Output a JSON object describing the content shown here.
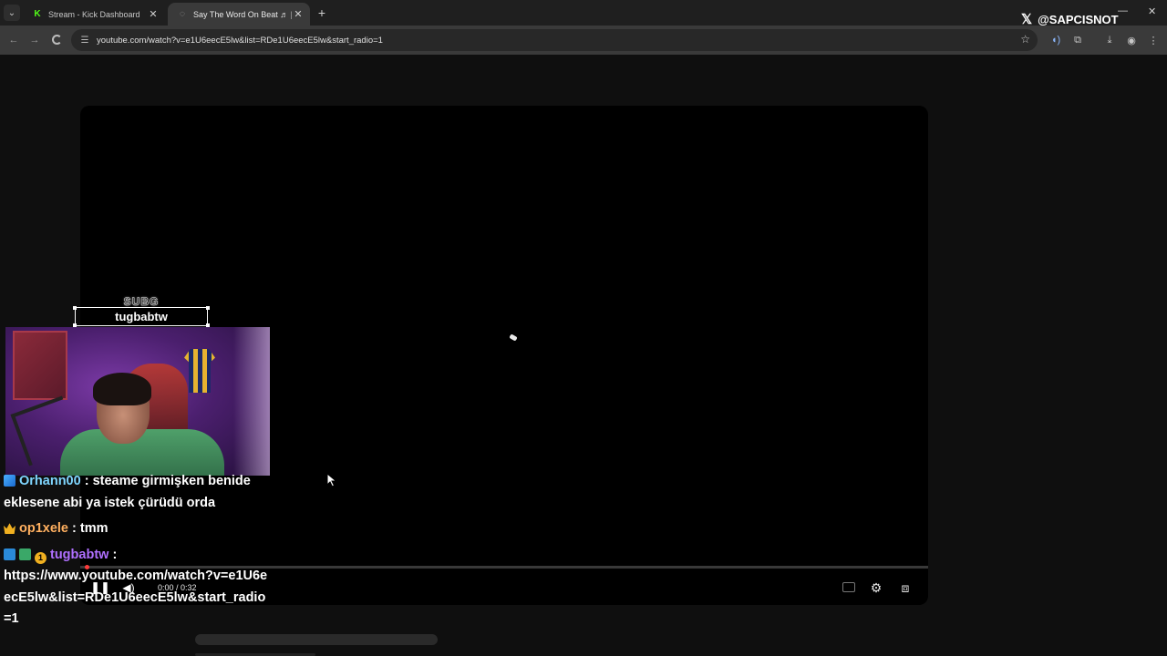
{
  "browser": {
    "tabs": [
      {
        "title": "Stream - Kick Dashboard",
        "active": false,
        "favicon": "kick-logo"
      },
      {
        "title": "Say The Word On Beat ♬ | Se",
        "active": true,
        "favicon": "loading-icon"
      }
    ],
    "address": "youtube.com/watch?v=e1U6eecE5lw&list=RDe1U6eecE5lw&start_radio=1"
  },
  "overlay": {
    "handle": "@SAPCISNOT",
    "sub_alert": {
      "title": "SUBG",
      "username": "tugbabtw"
    }
  },
  "player": {
    "time": "0:00 / 0:32"
  },
  "chat": {
    "messages": [
      {
        "user": "Orhann00",
        "sep": ": ",
        "text": "steame girmişken benide eklesene abi ya istek çürüdü orda",
        "badges": [
          "cube"
        ]
      },
      {
        "user": "op1xele",
        "sep": ": ",
        "text": "tmm",
        "badges": [
          "crown"
        ]
      },
      {
        "user": "tugbabtw",
        "sep": ":",
        "text": "https://www.youtube.com/watch?v=e1U6eecE5lw&list=RDe1U6eecE5lw&start_radio=1",
        "badges": [
          "b1",
          "b2",
          "b3"
        ],
        "badge_number": "1"
      }
    ]
  },
  "colors": {
    "name_orhann": "#7fd6ff",
    "name_op1xele": "#ffb060",
    "name_tugbabtw": "#b070ff"
  }
}
